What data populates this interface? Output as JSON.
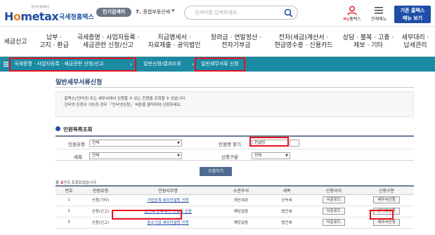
{
  "header": {
    "logo_mark_prefix": "H",
    "logo_mark_o": "o",
    "logo_mark_rest": "metax",
    "logo_tagline": "국민과 함께하는",
    "logo_name": "국세청홈택스",
    "popular_label": "인기검색어",
    "popular_rank": "7.",
    "popular_term": "종합부동산세",
    "search_placeholder": "검색어를 입력하세요.",
    "my_hometax_prefix": "My",
    "my_hometax_suffix": "홈택스",
    "full_menu_label": "전체메뉴",
    "legacy_line1": "기존 홈택스",
    "legacy_line2": "메뉴 보기"
  },
  "main_menu": [
    {
      "line1": "세금신고",
      "line2": ""
    },
    {
      "line1": "납부 ·",
      "line2": "고지 · 환급"
    },
    {
      "line1": "국세증명 · 사업자등록 ·",
      "line2": "세금관련 신청/신고"
    },
    {
      "line1": "지급명세서 ·",
      "line2": "자료제출 · 공익법인"
    },
    {
      "line1": "장려금 · 연말정산 ·",
      "line2": "전자기부금"
    },
    {
      "line1": "전자(세금)계산서 ·",
      "line2": "현금영수증 · 신용카드"
    },
    {
      "line1": "상담 · 불복 · 고충 ·",
      "line2": "제보 · 기타"
    },
    {
      "line1": "세무대리 ·",
      "line2": "납세관리"
    }
  ],
  "breadcrumb": {
    "level1": "국세증명 · 사업자등록 · 세금관련 신청/신고",
    "level2": "일반신청/결과조회",
    "level3": "일반세무서류 신청"
  },
  "page": {
    "title": "일반세무서류신청",
    "notice_line1": "· 홈택스(인터넷) 또는 세무서에서 신청할 수 있는 민원을 조회할 수 있습니다.",
    "notice_line2": "· 인터넷 신청이 가능한 경우 「인터넷신청」 버튼을 클릭하여 신청하세요."
  },
  "search_form": {
    "section_title": "민원목록조회",
    "category_label": "민원유형",
    "category_value": "전체",
    "name_label": "민원명 찾기",
    "name_value": "컨설팅",
    "tax_label": "세목",
    "tax_value": "전체",
    "apply_type_label": "신청구분",
    "apply_type_value": "전체",
    "search_button": "조회하기"
  },
  "results": {
    "count_prefix": "총 ",
    "count_value": "3",
    "count_suffix": "건이 조회되었습니다.",
    "columns": [
      "번호",
      "민원유형",
      "민원사무명",
      "소관부서",
      "세목",
      "신청서식",
      "신청구분"
    ],
    "rows": [
      {
        "no": "1",
        "type": "신청(기타)",
        "name": "가업승계 세무컨설팅 신청",
        "dept": "재산세과",
        "tax": "상속세",
        "form": "다운로드",
        "apply": "세무서신청"
      },
      {
        "no": "2",
        "type": "신청(신고)",
        "name": "법인세 공제·감면 컨설팅 신청",
        "dept": "해당없음",
        "tax": "법인세",
        "form": "다운로드",
        "apply": "인터넷신청"
      },
      {
        "no": "3",
        "type": "신청(신고)",
        "name": "중소기업 세무컨설팅 신청",
        "dept": "해당없음",
        "tax": "법인세",
        "form": "다운로드",
        "apply": "세무서신청"
      }
    ]
  },
  "colors": {
    "brand_blue": "#1f4ea8",
    "breadcrumb_teal": "#1b8aa3",
    "highlight_red": "#e8101b"
  }
}
